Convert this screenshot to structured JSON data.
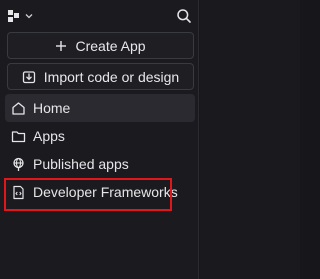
{
  "header": {
    "logo_icon": "workspace-logo-icon",
    "dropdown_icon": "chevron-down-icon",
    "search_icon": "search-icon"
  },
  "actions": {
    "create_app_label": "Create App",
    "import_label": "Import code or design"
  },
  "nav": {
    "items": [
      {
        "label": "Home",
        "icon": "home-icon",
        "active": true
      },
      {
        "label": "Apps",
        "icon": "folder-icon",
        "active": false
      },
      {
        "label": "Published apps",
        "icon": "globe-icon",
        "active": false
      },
      {
        "label": "Developer Frameworks",
        "icon": "code-file-icon",
        "active": false
      }
    ]
  },
  "colors": {
    "sidebar_bg": "#1b1b1f",
    "main_bg": "#1a1a1e",
    "active_item_bg": "#2a2a30",
    "highlight_border": "#e0161d",
    "text": "#e6e6e9"
  }
}
